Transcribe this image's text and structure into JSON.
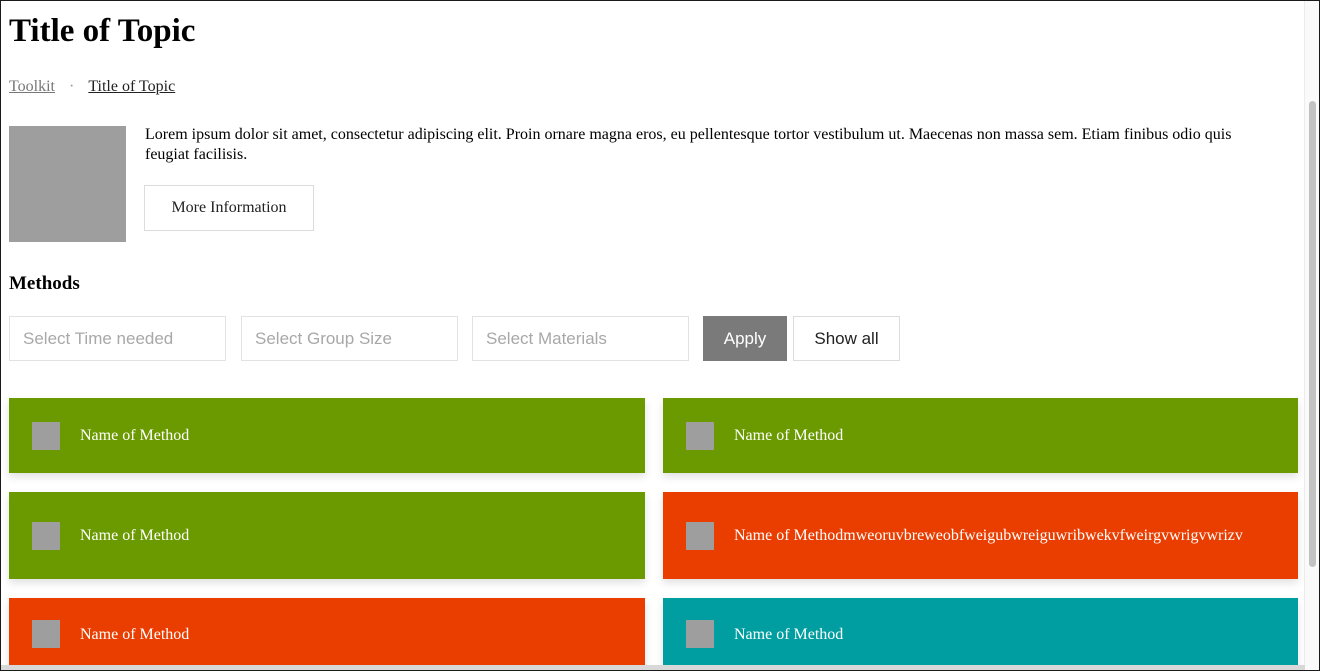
{
  "page": {
    "title": "Title of Topic"
  },
  "breadcrumb": {
    "items": [
      "Toolkit",
      "Title of Topic"
    ],
    "separator": "·"
  },
  "intro": {
    "description": "Lorem ipsum dolor sit amet, consectetur adipiscing elit. Proin ornare magna eros, eu pellentesque tortor vestibulum ut. Maecenas non massa sem. Etiam finibus odio quis feugiat facilisis.",
    "more_info_label": "More Information"
  },
  "methods": {
    "heading": "Methods",
    "filters": {
      "time_placeholder": "Select Time needed",
      "group_placeholder": "Select Group Size",
      "materials_placeholder": "Select Materials",
      "apply_label": "Apply",
      "show_all_label": "Show all"
    },
    "cards": [
      {
        "name": "Name of Method",
        "color": "#6a9a00"
      },
      {
        "name": "Name of Method",
        "color": "#6a9a00"
      },
      {
        "name": "Name of Method",
        "color": "#6a9a00"
      },
      {
        "name": "Name of Methodmweoruvbreweobfweigubwreiguwribwekvfweirgvwrigvwrizv",
        "color": "#ea3d00"
      },
      {
        "name": "Name of Method",
        "color": "#ea3d00"
      },
      {
        "name": "Name of Method",
        "color": "#009ea0"
      }
    ]
  },
  "colors": {
    "green": "#6a9a00",
    "orange": "#ea3d00",
    "teal": "#009ea0",
    "placeholder_gray": "#9e9e9e",
    "apply_button": "#7a7a7a"
  }
}
